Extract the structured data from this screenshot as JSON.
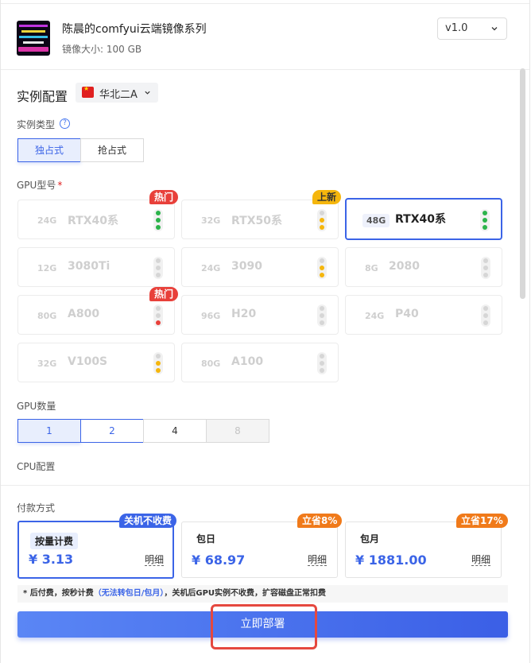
{
  "header": {
    "title": "陈晨的comfyui云端镜像系列",
    "size_label": "镜像大小: 100 GB",
    "version": "v1.0"
  },
  "instance": {
    "section_title": "实例配置",
    "region": "华北二A",
    "type_label": "实例类型",
    "types": [
      "独占式",
      "抢占式"
    ],
    "gpu_model_label": "GPU型号",
    "required_mark": "*",
    "gpus": [
      {
        "mem": "24G",
        "name": "RTX40系",
        "badge": "热门"
      },
      {
        "mem": "32G",
        "name": "RTX50系",
        "badge": "上新"
      },
      {
        "mem": "48G",
        "name": "RTX40系",
        "badge": ""
      },
      {
        "mem": "12G",
        "name": "3080Ti",
        "badge": ""
      },
      {
        "mem": "24G",
        "name": "3090",
        "badge": ""
      },
      {
        "mem": "8G",
        "name": "2080",
        "badge": ""
      },
      {
        "mem": "80G",
        "name": "A800",
        "badge": "热门"
      },
      {
        "mem": "96G",
        "name": "H20",
        "badge": ""
      },
      {
        "mem": "24G",
        "name": "P40",
        "badge": ""
      },
      {
        "mem": "32G",
        "name": "V100S",
        "badge": ""
      },
      {
        "mem": "80G",
        "name": "A100",
        "badge": ""
      }
    ],
    "gpu_count_label": "GPU数量",
    "gpu_counts": [
      "1",
      "2",
      "4",
      "8"
    ],
    "cpu_label": "CPU配置"
  },
  "billing": {
    "label": "付款方式",
    "options": [
      {
        "name": "按量计费",
        "price": "¥ 3.13",
        "badge": "关机不收费",
        "detail": "明细"
      },
      {
        "name": "包日",
        "price": "¥ 68.97",
        "badge": "立省8%",
        "detail": "明细"
      },
      {
        "name": "包月",
        "price": "¥ 1881.00",
        "badge": "立省17%",
        "detail": "明细"
      }
    ],
    "note_prefix": "* 后付费，按秒计费",
    "note_highlight": "（无法转包日/包月）",
    "note_suffix": "，关机后GPU实例不收费，扩容磁盘正常扣费"
  },
  "deploy_label": "立即部署",
  "colors": {
    "accent": "#3b64e7",
    "hot": "#e8403a",
    "new": "#f5b60d",
    "save": "#f07a1a",
    "highlight_box": "#e5483f"
  }
}
